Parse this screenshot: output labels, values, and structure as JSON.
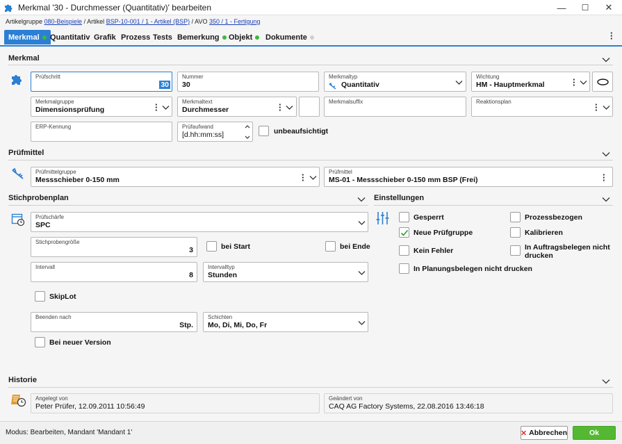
{
  "window": {
    "title": "Merkmal '30 - Durchmesser (Quantitativ)' bearbeiten",
    "app_icon": "puzzle-icon",
    "minimize": "—",
    "maximize": "☐",
    "close": "✕"
  },
  "breadcrumb": {
    "prefix_1": "Artikelgruppe ",
    "link_1": "080-Beispiele",
    "prefix_2": " / Artikel ",
    "link_2": "BSP-10-001 / 1 - Artikel (BSP)",
    "prefix_3": " / AVO ",
    "link_3": "350 / 1 - Fertigung"
  },
  "tabs": [
    {
      "label": "Merkmal",
      "dot": "green"
    },
    {
      "label": "Quantitativ"
    },
    {
      "label": "Grafik"
    },
    {
      "label": "Prozess"
    },
    {
      "label": "Tests"
    },
    {
      "label": "Bemerkung",
      "dot": "green"
    },
    {
      "label": "Objekt",
      "dot": "green"
    },
    {
      "label": "Dokumente",
      "dot": "grey"
    }
  ],
  "merkmal": {
    "title": "Merkmal",
    "pruefschritt": {
      "label": "Prüfschritt",
      "value": "30"
    },
    "nummer": {
      "label": "Nummer",
      "value": "30"
    },
    "merkmaltyp": {
      "label": "Merkmaltyp",
      "value": "Quantitativ"
    },
    "wichtung": {
      "label": "Wichtung",
      "value": "HM - Hauptmerkmal"
    },
    "merkmalgruppe": {
      "label": "Merkmalgruppe",
      "value": "Dimensionsprüfung"
    },
    "merkmaltext": {
      "label": "Merkmaltext",
      "value": "Durchmesser"
    },
    "merkmalsuffix": {
      "label": "Merkmalsuffix",
      "value": ""
    },
    "reaktionsplan": {
      "label": "Reaktionsplan",
      "value": ""
    },
    "erp_kennung": {
      "label": "ERP-Kennung",
      "value": ""
    },
    "pruefaufwand": {
      "label": "Prüfaufwand",
      "value": "[d.hh:mm:ss]"
    },
    "unbeaufsichtigt": {
      "label": "unbeaufsichtigt",
      "checked": false
    }
  },
  "pruefmittel": {
    "title": "Prüfmittel",
    "gruppe": {
      "label": "Prüfmittelgruppe",
      "value": "Messschieber 0-150 mm"
    },
    "mittel": {
      "label": "Prüfmittel",
      "value": "MS-01 - Messschieber 0-150 mm BSP (Frei)"
    }
  },
  "stichprobenplan": {
    "title": "Stichprobenplan",
    "pruefschaerfe": {
      "label": "Prüfschärfe",
      "value": "SPC"
    },
    "stichprobengroesse": {
      "label": "Stichprobengröße",
      "value": "3"
    },
    "bei_start": {
      "label": "bei Start",
      "checked": false
    },
    "bei_ende": {
      "label": "bei Ende",
      "checked": false
    },
    "intervall": {
      "label": "Intervall",
      "value": "8"
    },
    "intervalltyp": {
      "label": "Intervalltyp",
      "value": "Stunden"
    },
    "skiplot": {
      "label": "SkipLot",
      "checked": false
    },
    "beenden_nach": {
      "label": "Beenden nach",
      "value": "Stp."
    },
    "schichten": {
      "label": "Schichten",
      "value": "Mo, Di, Mi, Do, Fr"
    },
    "bei_neuer_version": {
      "label": "Bei neuer Version",
      "checked": false
    }
  },
  "einstellungen": {
    "title": "Einstellungen",
    "gesperrt": {
      "label": "Gesperrt",
      "checked": false
    },
    "neue_pruefgruppe": {
      "label": "Neue Prüfgruppe",
      "checked": true
    },
    "kein_fehler": {
      "label": "Kein Fehler",
      "checked": false
    },
    "in_planungsbelegen": {
      "label": "In Planungsbelegen nicht drucken",
      "checked": false
    },
    "prozessbezogen": {
      "label": "Prozessbezogen",
      "checked": false
    },
    "kalibrieren": {
      "label": "Kalibrieren",
      "checked": false
    },
    "in_auftragsbelegen_1": "In Auftragsbelegen nicht",
    "in_auftragsbelegen_2": "drucken"
  },
  "historie": {
    "title": "Historie",
    "angelegt": {
      "label": "Angelegt von",
      "value": "Peter Prüfer, 12.09.2011 10:56:49"
    },
    "geaendert": {
      "label": "Geändert von",
      "value": "CAQ AG Factory Systems, 22.08.2016 13:46:18"
    }
  },
  "status": {
    "text": "Modus: Bearbeiten, Mandant 'Mandant 1'",
    "cancel": "Abbrechen",
    "ok": "Ok"
  },
  "colors": {
    "accent": "#2b7fd4",
    "ok": "#55b832",
    "cancel_x": "#d9251d",
    "check": "#2e9a2e"
  }
}
